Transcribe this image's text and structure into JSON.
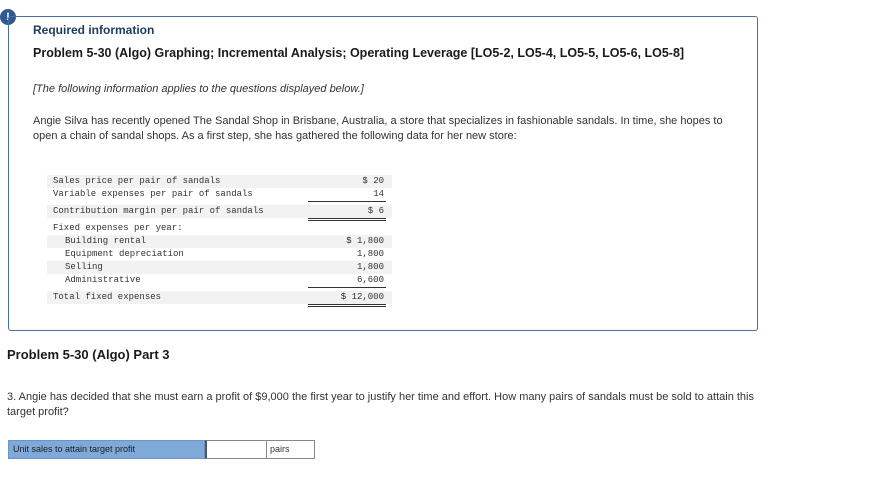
{
  "alert": {
    "icon": "exclamation-icon",
    "glyph": "!"
  },
  "info": {
    "heading": "Required information",
    "problem_title": "Problem 5-30 (Algo) Graphing; Incremental Analysis; Operating Leverage [LO5-2, LO5-4, LO5-5, LO5-6, LO5-8]",
    "note": "[The following information applies to the questions displayed below.]",
    "paragraph": "Angie Silva has recently opened The Sandal Shop in Brisbane, Australia, a store that specializes in fashionable sandals. In time, she hopes to open a chain of sandal shops. As a first step, she has gathered the following data for her new store:"
  },
  "table": {
    "rows": [
      {
        "label": "Sales price per pair of sandals",
        "value": "$ 20"
      },
      {
        "label": "Variable expenses per pair of sandals",
        "value": "14"
      },
      {
        "label": "Contribution margin per pair of sandals",
        "value": "$ 6"
      },
      {
        "label": "Fixed expenses per year:",
        "value": ""
      },
      {
        "label": "Building rental",
        "value": "$ 1,800"
      },
      {
        "label": "Equipment depreciation",
        "value": "1,800"
      },
      {
        "label": "Selling",
        "value": "1,800"
      },
      {
        "label": "Administrative",
        "value": "6,600"
      },
      {
        "label": "Total fixed expenses",
        "value": "$ 12,000"
      }
    ]
  },
  "part": {
    "title": "Problem 5-30 (Algo) Part 3",
    "question": "3. Angie has decided that she must earn a profit of $9,000 the first year to justify her time and effort. How many pairs of sandals must be sold to attain this target profit?"
  },
  "answer": {
    "label": "Unit sales to attain target profit",
    "value": "",
    "unit": "pairs"
  },
  "colors": {
    "accent": "#2f5a8f",
    "answer_label_bg": "#7ea9d8",
    "box_border": "#4a6d9a"
  }
}
